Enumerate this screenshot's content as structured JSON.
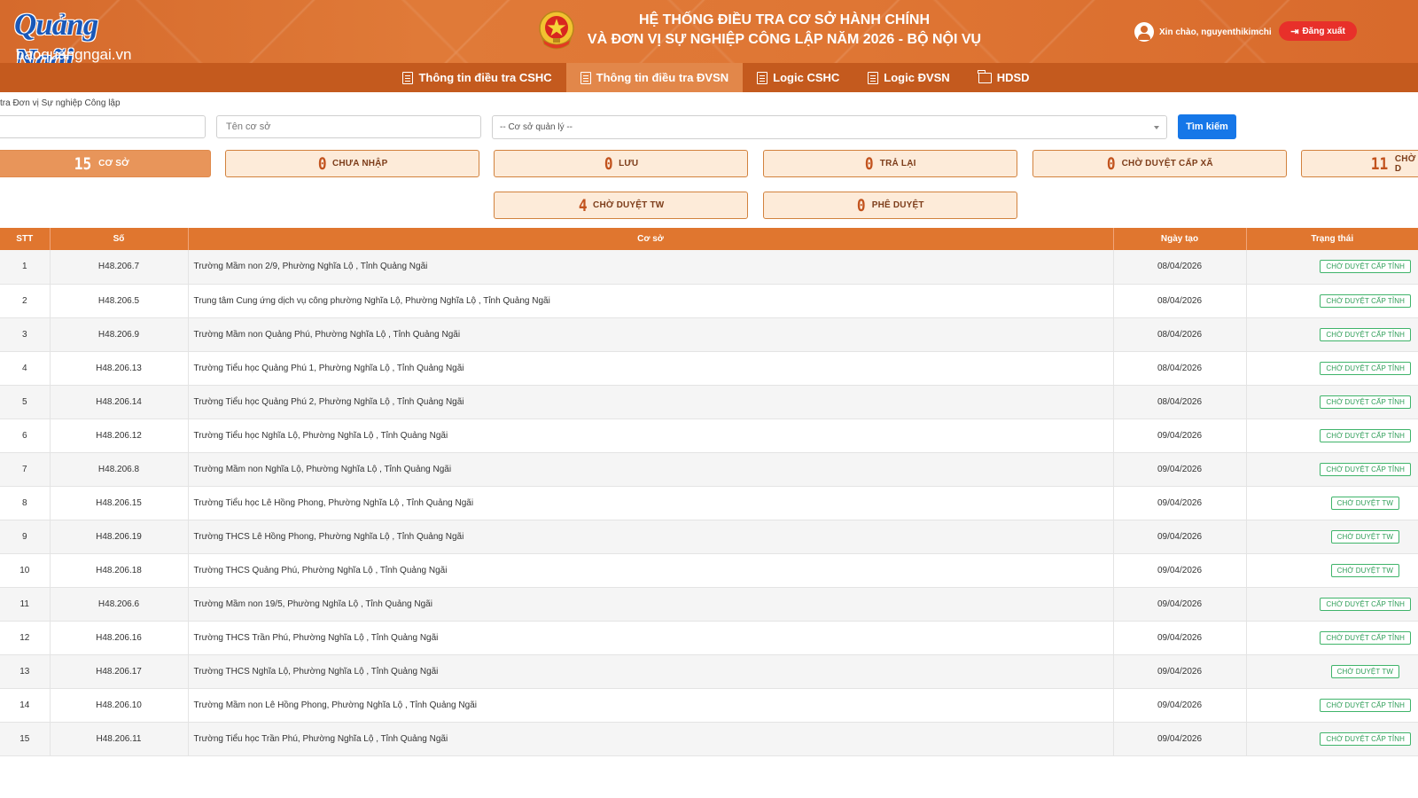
{
  "header": {
    "logo_main": "Quảng Ngãi",
    "logo_sub": "baoquangngai.vn",
    "title_line1": "HỆ THỐNG ĐIỀU TRA CƠ SỞ HÀNH CHÍNH",
    "title_line2": "VÀ ĐƠN VỊ SỰ NGHIỆP CÔNG LẬP NĂM 2026 - BỘ NỘI VỤ",
    "greeting": "Xin chào, nguyenthikimchi",
    "logout_label": "Đăng xuất"
  },
  "nav": [
    {
      "label": "Thông tin điều tra CSHC",
      "icon": "document-icon",
      "active": false
    },
    {
      "label": "Thông tin điều tra ĐVSN",
      "icon": "document-icon",
      "active": true
    },
    {
      "label": "Logic CSHC",
      "icon": "document-icon",
      "active": false
    },
    {
      "label": "Logic ĐVSN",
      "icon": "document-icon",
      "active": false
    },
    {
      "label": "HDSD",
      "icon": "folder-icon",
      "active": false
    }
  ],
  "breadcrumb": "tra Đơn vị Sự nghiệp Công lập",
  "filters": {
    "code_value": "",
    "name_placeholder": "Tên cơ sở",
    "manager_select": "-- Cơ sở quản lý --",
    "search_label": "Tìm kiếm"
  },
  "stats": [
    {
      "count": "15",
      "label": "CƠ SỞ"
    },
    {
      "count": "0",
      "label": "CHƯA NHẬP"
    },
    {
      "count": "0",
      "label": "LƯU"
    },
    {
      "count": "0",
      "label": "TRẢ LẠI"
    },
    {
      "count": "0",
      "label": "CHỜ DUYỆT CẤP XÃ"
    },
    {
      "count": "11",
      "label": "CHỜ D"
    },
    {
      "count": "4",
      "label": "CHỜ DUYỆT TW"
    },
    {
      "count": "0",
      "label": "PHÊ DUYỆT"
    }
  ],
  "table": {
    "headers": [
      "STT",
      "Số",
      "Cơ sở",
      "Ngày tạo",
      "Trạng thái"
    ],
    "rows": [
      {
        "stt": "1",
        "so": "H48.206.7",
        "coso": "Trường Mầm non 2/9, Phường Nghĩa Lộ , Tỉnh Quảng Ngãi",
        "ngay": "08/04/2026",
        "status": "CHỜ DUYỆT CẤP TỈNH"
      },
      {
        "stt": "2",
        "so": "H48.206.5",
        "coso": "Trung tâm Cung ứng dịch vụ công phường Nghĩa Lộ, Phường Nghĩa Lộ , Tỉnh Quảng Ngãi",
        "ngay": "08/04/2026",
        "status": "CHỜ DUYỆT CẤP TỈNH"
      },
      {
        "stt": "3",
        "so": "H48.206.9",
        "coso": "Trường Mầm non Quảng Phú, Phường Nghĩa Lộ , Tỉnh Quảng Ngãi",
        "ngay": "08/04/2026",
        "status": "CHỜ DUYỆT CẤP TỈNH"
      },
      {
        "stt": "4",
        "so": "H48.206.13",
        "coso": "Trường Tiểu học Quảng Phú 1, Phường Nghĩa Lộ , Tỉnh Quảng Ngãi",
        "ngay": "08/04/2026",
        "status": "CHỜ DUYỆT CẤP TỈNH"
      },
      {
        "stt": "5",
        "so": "H48.206.14",
        "coso": "Trường Tiểu học Quảng Phú 2, Phường Nghĩa Lộ , Tỉnh Quảng Ngãi",
        "ngay": "08/04/2026",
        "status": "CHỜ DUYỆT CẤP TỈNH"
      },
      {
        "stt": "6",
        "so": "H48.206.12",
        "coso": "Trường Tiểu học Nghĩa Lộ, Phường Nghĩa Lộ , Tỉnh Quảng Ngãi",
        "ngay": "09/04/2026",
        "status": "CHỜ DUYỆT CẤP TỈNH"
      },
      {
        "stt": "7",
        "so": "H48.206.8",
        "coso": "Trường Mầm non Nghĩa Lộ, Phường Nghĩa Lộ , Tỉnh Quảng Ngãi",
        "ngay": "09/04/2026",
        "status": "CHỜ DUYỆT CẤP TỈNH"
      },
      {
        "stt": "8",
        "so": "H48.206.15",
        "coso": "Trường Tiểu học Lê Hồng Phong, Phường Nghĩa Lộ , Tỉnh Quảng Ngãi",
        "ngay": "09/04/2026",
        "status": "CHỜ DUYỆT TW"
      },
      {
        "stt": "9",
        "so": "H48.206.19",
        "coso": "Trường THCS Lê Hồng Phong, Phường Nghĩa Lộ , Tỉnh Quảng Ngãi",
        "ngay": "09/04/2026",
        "status": "CHỜ DUYỆT TW"
      },
      {
        "stt": "10",
        "so": "H48.206.18",
        "coso": "Trường THCS Quảng Phú, Phường Nghĩa Lộ , Tỉnh Quảng Ngãi",
        "ngay": "09/04/2026",
        "status": "CHỜ DUYỆT TW"
      },
      {
        "stt": "11",
        "so": "H48.206.6",
        "coso": "Trường Mầm non 19/5, Phường Nghĩa Lộ , Tỉnh Quảng Ngãi",
        "ngay": "09/04/2026",
        "status": "CHỜ DUYỆT CẤP TỈNH"
      },
      {
        "stt": "12",
        "so": "H48.206.16",
        "coso": "Trường THCS Trần Phú, Phường Nghĩa Lộ , Tỉnh Quảng Ngãi",
        "ngay": "09/04/2026",
        "status": "CHỜ DUYỆT CẤP TỈNH"
      },
      {
        "stt": "13",
        "so": "H48.206.17",
        "coso": "Trường THCS Nghĩa Lộ, Phường Nghĩa Lộ , Tỉnh Quảng Ngãi",
        "ngay": "09/04/2026",
        "status": "CHỜ DUYỆT TW"
      },
      {
        "stt": "14",
        "so": "H48.206.10",
        "coso": "Trường Mầm non Lê Hồng Phong, Phường Nghĩa Lộ , Tỉnh Quảng Ngãi",
        "ngay": "09/04/2026",
        "status": "CHỜ DUYỆT CẤP TỈNH"
      },
      {
        "stt": "15",
        "so": "H48.206.11",
        "coso": "Trường Tiểu học Trần Phú, Phường Nghĩa Lộ , Tỉnh Quảng Ngãi",
        "ngay": "09/04/2026",
        "status": "CHỜ DUYỆT CẤP TỈNH"
      }
    ]
  },
  "colors": {
    "header_orange": "#e07a38",
    "nav_dark": "#c45a1e",
    "status_green": "#2e9d57",
    "search_blue": "#1677e8",
    "logout_red": "#e8302a"
  }
}
